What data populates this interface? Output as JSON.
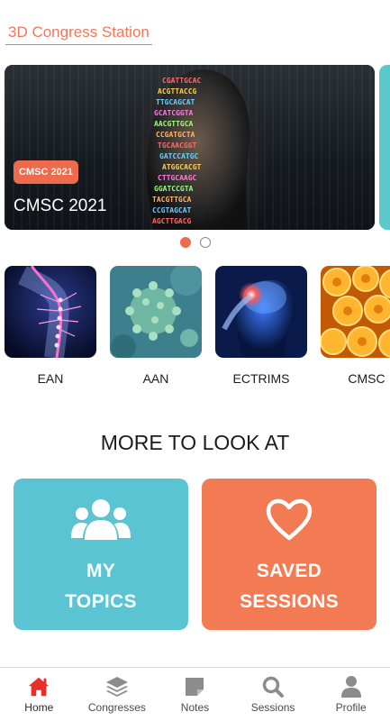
{
  "header": {
    "title": "3D Congress Station"
  },
  "carousel": {
    "slides": [
      {
        "badge": "CMSC 2021",
        "title": "CMSC 2021"
      }
    ],
    "page_count": 2,
    "active_index": 0
  },
  "categories": [
    {
      "label": "EAN",
      "image": "spine-image"
    },
    {
      "label": "AAN",
      "image": "virus-image"
    },
    {
      "label": "ECTRIMS",
      "image": "brain-pain-image"
    },
    {
      "label": "CMSC",
      "image": "cells-image"
    }
  ],
  "section": {
    "heading": "MORE TO LOOK AT"
  },
  "tiles": {
    "topics": {
      "line1": "MY",
      "line2": "TOPICS",
      "icon": "group-icon",
      "color": "#5bc4d2"
    },
    "saved": {
      "line1": "SAVED",
      "line2": "SESSIONS",
      "icon": "heart-icon",
      "color": "#f27b54"
    }
  },
  "nav": {
    "items": [
      {
        "label": "Home",
        "icon": "home-icon",
        "active": true
      },
      {
        "label": "Congresses",
        "icon": "layers-icon"
      },
      {
        "label": "Notes",
        "icon": "note-icon"
      },
      {
        "label": "Sessions",
        "icon": "search-icon"
      },
      {
        "label": "Profile",
        "icon": "person-icon"
      }
    ]
  },
  "colors": {
    "accent": "#f0775a",
    "teal": "#5bc4d2",
    "nav_icon": "#8c8c8c",
    "nav_active": "#e8302a"
  }
}
